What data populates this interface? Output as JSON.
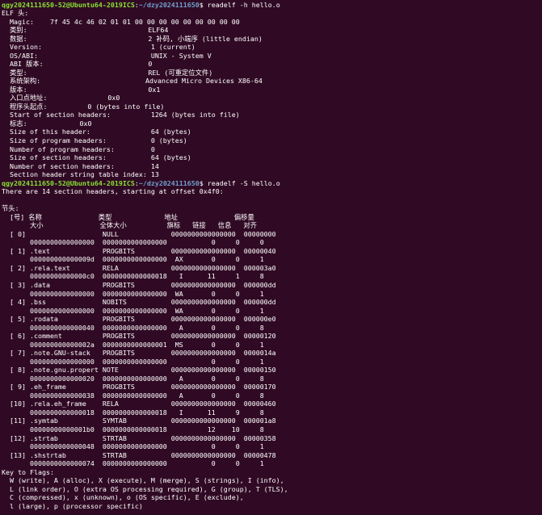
{
  "terminal": {
    "background": "#300a24",
    "text_color": "#ffffff",
    "prompt_user_color": "#8ae234",
    "prompt_path_color": "#729fcf",
    "commands": [
      {
        "user_host": "qgy2024111650-52@Ubuntu64-2019ICS",
        "path": "~/dzy2024111650",
        "symbol": "$ ",
        "command": "readelf -h hello.o"
      },
      {
        "user_host": "qgy2024111650-52@Ubuntu64-2019ICS",
        "path": "~/dzy2024111650",
        "symbol": "$ ",
        "command": "readelf -S hello.o"
      }
    ],
    "header_output": [
      "ELF 头:",
      "  Magic:    7f 45 4c 46 02 01 01 00 00 00 00 00 00 00 00 00",
      "  类别:                              ELF64",
      "  数据:                              2 补码, 小端序 (little endian)",
      "  Version:                           1 (current)",
      "  OS/ABI:                            UNIX - System V",
      "  ABI 版本:                          0",
      "  类型:                              REL (可重定位文件)",
      "  系统架构:                          Advanced Micro Devices X86-64",
      "  版本:                              0x1",
      "  入口点地址:               0x0",
      "  程序头起点:          0 (bytes into file)",
      "  Start of section headers:          1264 (bytes into file)",
      "  标志:             0x0",
      "  Size of this header:               64 (bytes)",
      "  Size of program headers:           0 (bytes)",
      "  Number of program headers:         0",
      "  Size of section headers:           64 (bytes)",
      "  Number of section headers:         14",
      "  Section header string table index: 13"
    ],
    "sections_intro": [
      "There are 14 section headers, starting at offset 0x4f0:",
      "",
      "节头:"
    ],
    "section_table_header": [
      "  [号] 名称              类型             地址              偏移量",
      "       大小              全体大小          旗标   链接   信息   对齐"
    ],
    "sections": [
      {
        "row1": "  [ 0]                   NULL             0000000000000000  00000000",
        "row2": "       0000000000000000  0000000000000000           0     0     0"
      },
      {
        "row1": "  [ 1] .text             PROGBITS         0000000000000000  00000040",
        "row2": "       000000000000009d  0000000000000000  AX       0     0     1"
      },
      {
        "row1": "  [ 2] .rela.text        RELA             0000000000000000  000003a0",
        "row2": "       00000000000000c0  0000000000000018   I      11     1     8"
      },
      {
        "row1": "  [ 3] .data             PROGBITS         0000000000000000  000000dd",
        "row2": "       0000000000000000  0000000000000000  WA       0     0     1"
      },
      {
        "row1": "  [ 4] .bss              NOBITS           0000000000000000  000000dd",
        "row2": "       0000000000000000  0000000000000000  WA       0     0     1"
      },
      {
        "row1": "  [ 5] .rodata           PROGBITS         0000000000000000  000000e0",
        "row2": "       0000000000000040  0000000000000000   A       0     0     8"
      },
      {
        "row1": "  [ 6] .comment          PROGBITS         0000000000000000  00000120",
        "row2": "       000000000000002a  0000000000000001  MS       0     0     1"
      },
      {
        "row1": "  [ 7] .note.GNU-stack   PROGBITS         0000000000000000  0000014a",
        "row2": "       0000000000000000  0000000000000000           0     0     1"
      },
      {
        "row1": "  [ 8] .note.gnu.propert NOTE             0000000000000000  00000150",
        "row2": "       0000000000000020  0000000000000000   A       0     0     8"
      },
      {
        "row1": "  [ 9] .eh_frame         PROGBITS         0000000000000000  00000170",
        "row2": "       0000000000000038  0000000000000000   A       0     0     8"
      },
      {
        "row1": "  [10] .rela.eh_frame    RELA             0000000000000000  00000460",
        "row2": "       0000000000000018  0000000000000018   I      11     9     8"
      },
      {
        "row1": "  [11] .symtab           SYMTAB           0000000000000000  000001a8",
        "row2": "       00000000000001b0  0000000000000018          12    10     8"
      },
      {
        "row1": "  [12] .strtab           STRTAB           0000000000000000  00000358",
        "row2": "       0000000000000048  0000000000000000           0     0     1"
      },
      {
        "row1": "  [13] .shstrtab         STRTAB           0000000000000000  00000478",
        "row2": "       0000000000000074  0000000000000000           0     0     1"
      }
    ],
    "flags_key": [
      "Key to Flags:",
      "  W (write), A (alloc), X (execute), M (merge), S (strings), I (info),",
      "  L (link order), O (extra OS processing required), G (group), T (TLS),",
      "  C (compressed), x (unknown), o (OS specific), E (exclude),",
      "  l (large), p (processor specific)"
    ]
  }
}
